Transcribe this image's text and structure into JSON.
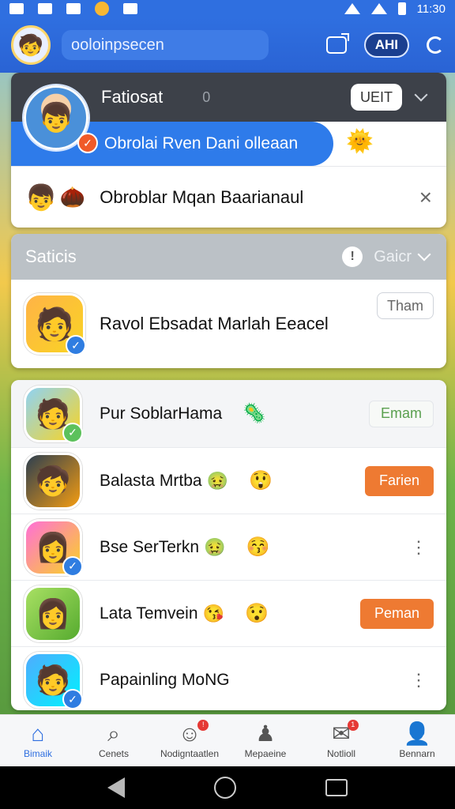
{
  "status_bar": {
    "time": "11:30"
  },
  "header": {
    "search_text": "ooloinpsecen",
    "ai_label": "AHI",
    "avatar_icon": "profile-avatar-icon"
  },
  "card1": {
    "title": "Fatiosat",
    "count": "0",
    "button_label": "UEIT",
    "bubble_text": "Obrolai Rven Dani olleaan",
    "row2_text": "Obroblar Mqan Baarianaul"
  },
  "card2": {
    "title": "Saticis",
    "filter_label": "Gaicr",
    "name": "Ravol Ebsadat Marlah Eeacel",
    "button_label": "Tham"
  },
  "list": [
    {
      "name": "Pur SoblarHama",
      "emo1": "",
      "emo2": "🦠",
      "action_type": "outline",
      "action_label": "Emam",
      "verified": "green"
    },
    {
      "name": "Balasta Mrtba",
      "emo1": "🤢",
      "emo2": "😲",
      "action_type": "orange",
      "action_label": "Farien",
      "verified": ""
    },
    {
      "name": "Bse SerTerkn",
      "emo1": "🤢",
      "emo2": "😚",
      "action_type": "kebab",
      "action_label": "⋮",
      "verified": "blue"
    },
    {
      "name": "Lata Temvein",
      "emo1": "😘",
      "emo2": "😯",
      "action_type": "orange",
      "action_label": "Peman",
      "verified": ""
    },
    {
      "name": "Papainling MoNG",
      "emo1": "",
      "emo2": "",
      "action_type": "kebab",
      "action_label": "⋮",
      "verified": "blue"
    }
  ],
  "bottom_nav": [
    {
      "label": "Bimaik",
      "icon": "home-icon",
      "active": true
    },
    {
      "label": "Cenets",
      "icon": "search-icon",
      "active": false
    },
    {
      "label": "Nodigntaatlen",
      "icon": "face-icon",
      "active": false
    },
    {
      "label": "Mepaeine",
      "icon": "person-icon",
      "active": false
    },
    {
      "label": "Notlioll",
      "icon": "mail-icon",
      "active": false
    },
    {
      "label": "Bennarn",
      "icon": "account-icon",
      "active": false
    }
  ]
}
